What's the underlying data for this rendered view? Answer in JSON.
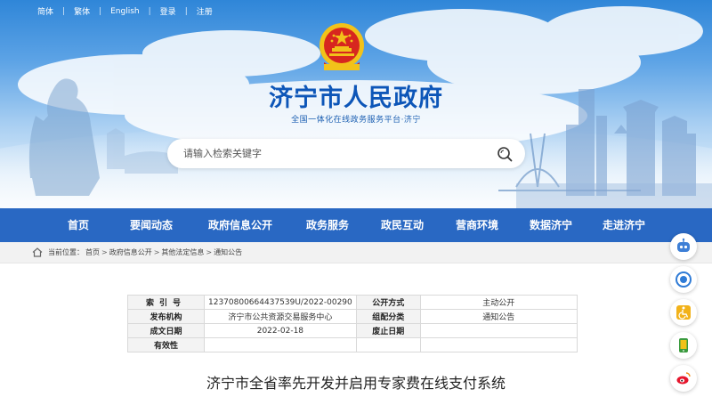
{
  "top_links": [
    "简体",
    "繁体",
    "English",
    "登录",
    "注册"
  ],
  "site": {
    "title": "济宁市人民政府",
    "subtitle": "全国一体化在线政务服务平台·济宁"
  },
  "search": {
    "placeholder": "请输入检索关键字"
  },
  "nav": [
    "首页",
    "要闻动态",
    "政府信息公开",
    "政务服务",
    "政民互动",
    "营商环境",
    "数据济宁",
    "走进济宁"
  ],
  "breadcrumb": {
    "label": "当前位置：",
    "items": [
      "首页",
      "政府信息公开",
      "其他法定信息",
      "通知公告"
    ]
  },
  "info": {
    "rows": [
      [
        "索引号",
        "12370800664437539U/2022-00290",
        "公开方式",
        "主动公开"
      ],
      [
        "发布机构",
        "济宁市公共资源交易服务中心",
        "组配分类",
        "通知公告"
      ],
      [
        "成文日期",
        "2022-02-18",
        "废止日期",
        ""
      ],
      [
        "有效性",
        "",
        "",
        ""
      ]
    ]
  },
  "article": {
    "title": "济宁市全省率先开发并启用专家费在线支付系统"
  },
  "tools": [
    "robot-assistant-icon",
    "elder-care-mode-icon",
    "accessibility-wheelchair-icon",
    "mobile-app-icon",
    "weibo-icon"
  ],
  "colors": {
    "nav_bg": "#2968c3",
    "title": "#0d56b8",
    "emblem_red": "#d7261f",
    "emblem_gold": "#f2c21a"
  }
}
